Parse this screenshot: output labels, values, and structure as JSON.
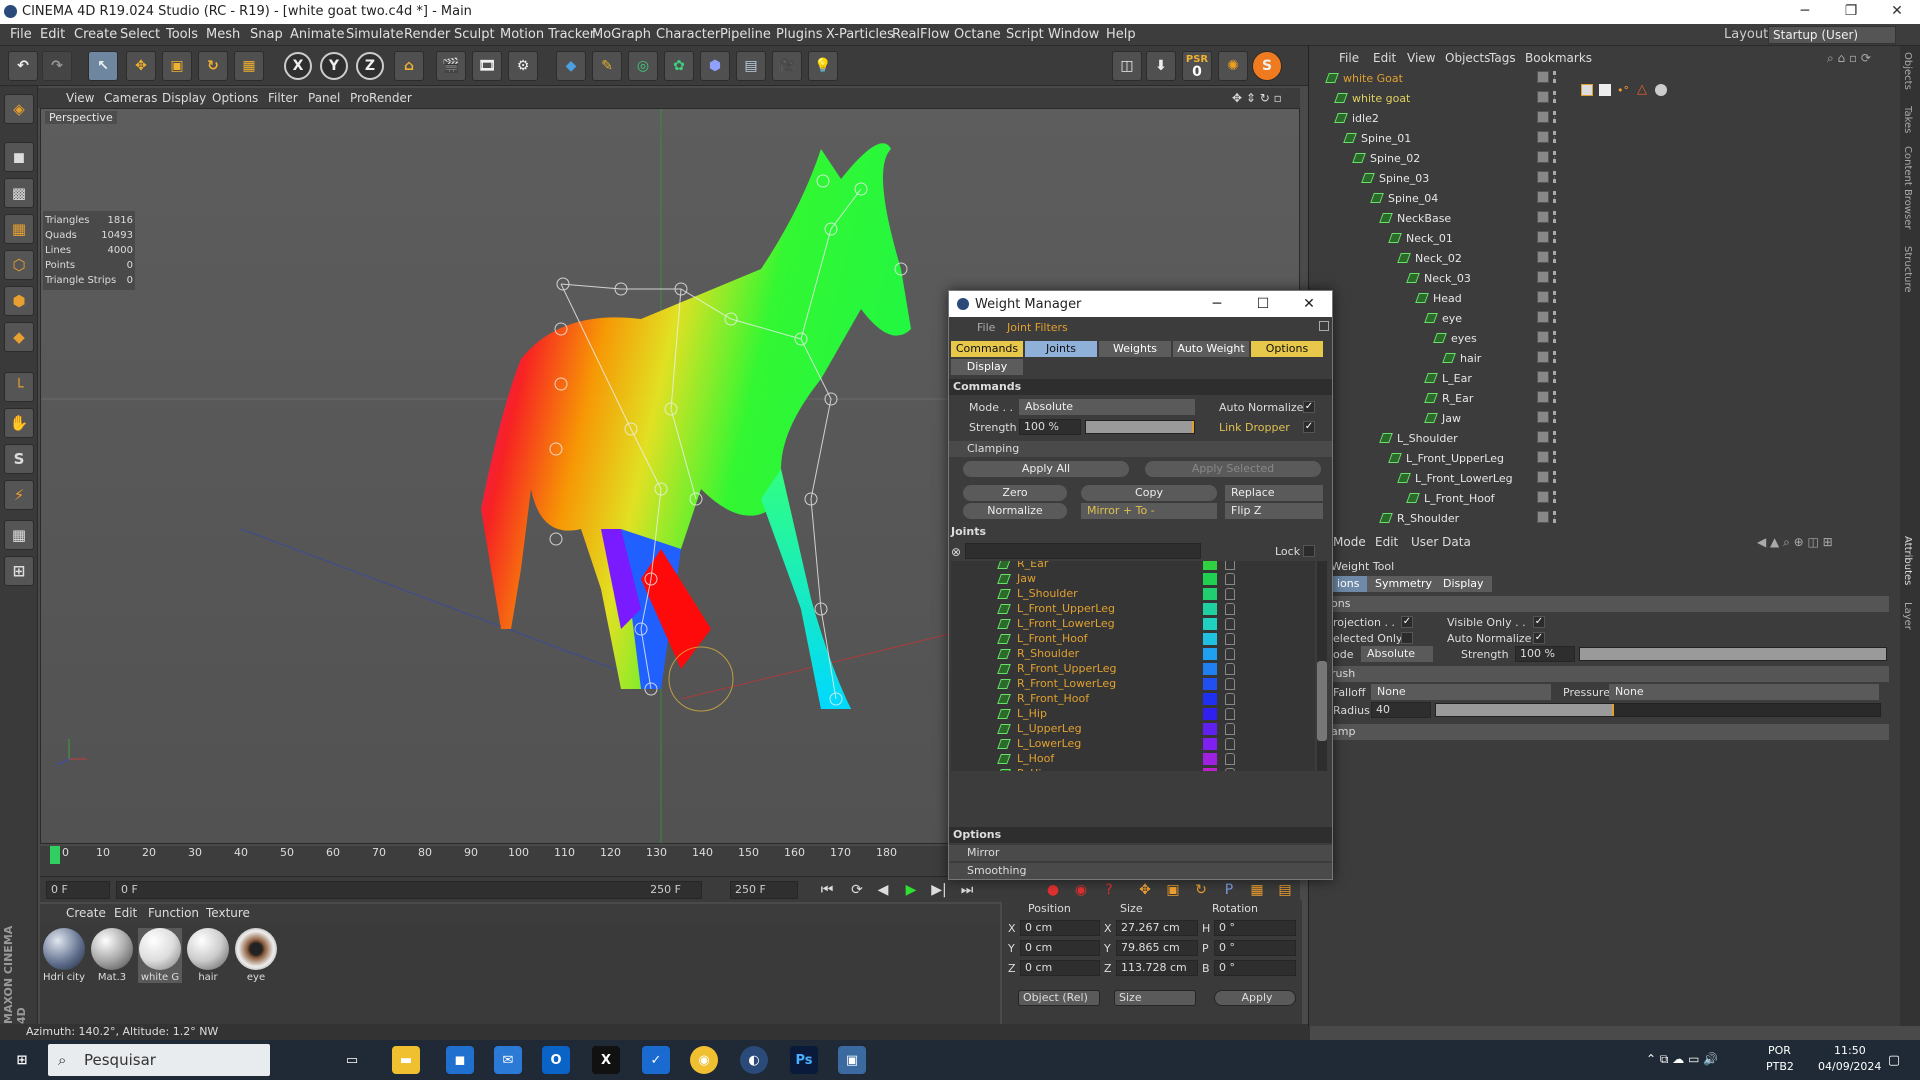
{
  "window": {
    "title": "CINEMA 4D R19.024 Studio (RC - R19) - [white goat two.c4d *] - Main"
  },
  "menu": [
    "File",
    "Edit",
    "Create",
    "Select",
    "Tools",
    "Mesh",
    "Snap",
    "Animate",
    "Simulate",
    "Render",
    "Sculpt",
    "Motion Tracker",
    "MoGraph",
    "Character",
    "Pipeline",
    "Plugins",
    "X-Particles",
    "RealFlow",
    "Octane",
    "Script",
    "Window",
    "Help"
  ],
  "layout": {
    "label": "Layout:",
    "value": "Startup (User)"
  },
  "toolbar": {
    "x": "X",
    "y": "Y",
    "z": "Z",
    "psr": "PSR",
    "psr_val": "0",
    "s": "S"
  },
  "viewport": {
    "menu": [
      "View",
      "Cameras",
      "Display",
      "Options",
      "Filter",
      "Panel",
      "ProRender"
    ],
    "label": "Perspective",
    "stats": [
      [
        "Triangles",
        "1816"
      ],
      [
        "Quads",
        "10493"
      ],
      [
        "Lines",
        "4000"
      ],
      [
        "Points",
        "0"
      ],
      [
        "Triangle Strips",
        "0"
      ]
    ]
  },
  "timeline": {
    "ticks": [
      "0",
      "10",
      "20",
      "30",
      "40",
      "50",
      "60",
      "70",
      "80",
      "90",
      "100",
      "110",
      "120",
      "130",
      "140",
      "150",
      "160",
      "170",
      "180"
    ],
    "start": "0 F",
    "start2": "0 F",
    "end": "250 F",
    "end2": "250 F"
  },
  "materials": {
    "menu": [
      "Create",
      "Edit",
      "Function",
      "Texture"
    ],
    "items": [
      {
        "name": "Hdri city",
        "color": "#7f8aa0"
      },
      {
        "name": "Mat.3",
        "color": "#bdbdbd"
      },
      {
        "name": "white G",
        "color": "#e6e6e6"
      },
      {
        "name": "hair",
        "color": "#d6d6d6"
      },
      {
        "name": "eye",
        "color": "#6a4630"
      }
    ]
  },
  "coord": {
    "headers": [
      "Position",
      "Size",
      "Rotation"
    ],
    "rows": [
      {
        "axis": "X",
        "pos": "0 cm",
        "saxis": "X",
        "size": "27.267 cm",
        "raxis": "H",
        "rot": "0 °"
      },
      {
        "axis": "Y",
        "pos": "0 cm",
        "saxis": "Y",
        "size": "79.865 cm",
        "raxis": "P",
        "rot": "0 °"
      },
      {
        "axis": "Z",
        "pos": "0 cm",
        "saxis": "Z",
        "size": "113.728 cm",
        "raxis": "B",
        "rot": "0 °"
      }
    ],
    "mode": "Object (Rel)",
    "size_mode": "Size",
    "apply": "Apply"
  },
  "statusbar": "Azimuth: 140.2°, Altitude: 1.2° NW",
  "brand": "MAXON CINEMA 4D",
  "objects": {
    "menu": [
      "File",
      "Edit",
      "View",
      "Objects",
      "Tags",
      "Bookmarks"
    ],
    "rows": [
      {
        "name": "white Goat",
        "indent": 0,
        "color": "#e0a030"
      },
      {
        "name": "white goat",
        "indent": 1,
        "color": "#e0d060"
      },
      {
        "name": "idle2",
        "indent": 1,
        "color": "#e6e6e6"
      },
      {
        "name": "Spine_01",
        "indent": 2,
        "color": "#e6e6e6"
      },
      {
        "name": "Spine_02",
        "indent": 3,
        "color": "#e6e6e6"
      },
      {
        "name": "Spine_03",
        "indent": 4,
        "color": "#e6e6e6"
      },
      {
        "name": "Spine_04",
        "indent": 5,
        "color": "#e6e6e6"
      },
      {
        "name": "NeckBase",
        "indent": 6,
        "color": "#e6e6e6"
      },
      {
        "name": "Neck_01",
        "indent": 7,
        "color": "#e6e6e6"
      },
      {
        "name": "Neck_02",
        "indent": 8,
        "color": "#e6e6e6"
      },
      {
        "name": "Neck_03",
        "indent": 9,
        "color": "#e6e6e6"
      },
      {
        "name": "Head",
        "indent": 10,
        "color": "#e6e6e6"
      },
      {
        "name": "eye",
        "indent": 11,
        "color": "#e6e6e6"
      },
      {
        "name": "eyes",
        "indent": 12,
        "color": "#e6e6e6"
      },
      {
        "name": "hair",
        "indent": 13,
        "color": "#e6e6e6"
      },
      {
        "name": "L_Ear",
        "indent": 11,
        "color": "#e6e6e6"
      },
      {
        "name": "R_Ear",
        "indent": 11,
        "color": "#e6e6e6"
      },
      {
        "name": "Jaw",
        "indent": 11,
        "color": "#e6e6e6"
      },
      {
        "name": "L_Shoulder",
        "indent": 6,
        "color": "#e6e6e6"
      },
      {
        "name": "L_Front_UpperLeg",
        "indent": 7,
        "color": "#e6e6e6"
      },
      {
        "name": "L_Front_LowerLeg",
        "indent": 8,
        "color": "#e6e6e6"
      },
      {
        "name": "L_Front_Hoof",
        "indent": 9,
        "color": "#e6e6e6"
      },
      {
        "name": "R_Shoulder",
        "indent": 6,
        "color": "#e6e6e6"
      }
    ]
  },
  "attributes": {
    "menu": [
      "Mode",
      "Edit",
      "User Data"
    ],
    "title": "Weight Tool",
    "tabs": [
      "ions",
      "Symmetry",
      "Display"
    ],
    "sec1": "ons",
    "projection": "rojection . .",
    "selected_only": "elected Only",
    "visible_only": "Visible Only . .",
    "auto_normalize": "Auto Normalize",
    "mode_label": "ode",
    "mode_value": "Absolute",
    "strength_label": "Strength",
    "strength_value": "100 %",
    "strength_fill": 1.0,
    "brush": "rush",
    "falloff_label": "Falloff",
    "falloff_value": "None",
    "pressure_label": "Pressure",
    "pressure_value": "None",
    "radius_label": "Radius",
    "radius_value": "40",
    "radius_fill": 0.4,
    "clamp": "amp"
  },
  "sidetabs": [
    "Objects",
    "Takes",
    "Content Browser",
    "Structure",
    "Attributes",
    "Layer"
  ],
  "wm": {
    "title": "Weight Manager",
    "menu": [
      "File",
      "Joint Filters"
    ],
    "tabs": [
      "Commands",
      "Joints",
      "Weights",
      "Auto Weight",
      "Options",
      "Display"
    ],
    "commands_header": "Commands",
    "mode_label": "Mode . .",
    "mode_value": "Absolute",
    "auto_normalize": "Auto Normalize",
    "strength_label": "Strength",
    "strength_value": "100 %",
    "strength_fill": 1.0,
    "link_dropper": "Link Dropper",
    "clamping": "Clamping",
    "apply_all": "Apply All",
    "apply_selected": "Apply Selected",
    "zero": "Zero",
    "copy": "Copy",
    "replace": "Replace",
    "normalize": "Normalize",
    "mirror": "Mirror + To -",
    "flipz": "Flip Z",
    "joints_header": "Joints",
    "lock": "Lock",
    "joints": [
      {
        "name": "R_Ear",
        "color": "#30d040"
      },
      {
        "name": "Jaw",
        "color": "#20d050"
      },
      {
        "name": "L_Shoulder",
        "color": "#20d070"
      },
      {
        "name": "L_Front_UpperLeg",
        "color": "#20d0a0"
      },
      {
        "name": "L_Front_LowerLeg",
        "color": "#20d0c0"
      },
      {
        "name": "L_Front_Hoof",
        "color": "#20c0e0"
      },
      {
        "name": "R_Shoulder",
        "color": "#20a0f0"
      },
      {
        "name": "R_Front_UpperLeg",
        "color": "#2080f0"
      },
      {
        "name": "R_Front_LowerLeg",
        "color": "#2050f0"
      },
      {
        "name": "R_Front_Hoof",
        "color": "#2030f0"
      },
      {
        "name": "L_Hip",
        "color": "#3020f0"
      },
      {
        "name": "L_UpperLeg",
        "color": "#6020f0"
      },
      {
        "name": "L_LowerLeg",
        "color": "#8020f0"
      },
      {
        "name": "L_Hoof",
        "color": "#a020e0"
      },
      {
        "name": "R_Hip",
        "color": "#c020d0"
      }
    ],
    "options_header": "Options",
    "mirror_section": "Mirror",
    "smoothing_section": "Smoothing"
  },
  "taskbar": {
    "search": "Pesquisar",
    "lang1": "POR",
    "lang2": "PTB2",
    "time": "11:50",
    "date": "04/09/2024"
  }
}
